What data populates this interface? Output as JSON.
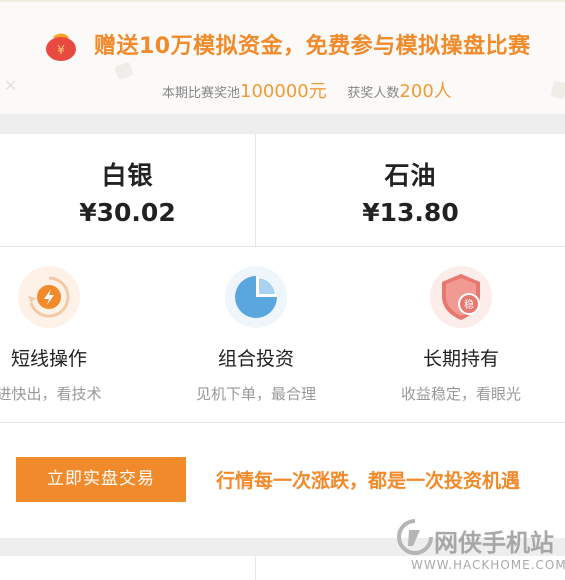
{
  "banner": {
    "title": "赠送10万模拟资金，免费参与模拟操盘比赛",
    "prize_label": "本期比赛奖池",
    "prize_value": "100000元",
    "winners_label": "获奖人数",
    "winners_value": "200人"
  },
  "prices": [
    {
      "name": "白银",
      "value": "¥30.02"
    },
    {
      "name": "石油",
      "value": "¥13.80"
    }
  ],
  "features": [
    {
      "title": "短线操作",
      "desc": "进快出，看技术",
      "icon": "lightning-refresh-icon"
    },
    {
      "title": "组合投资",
      "desc": "见机下单，最合理",
      "icon": "pie-chart-icon"
    },
    {
      "title": "长期持有",
      "desc": "收益稳定，看眼光",
      "icon": "shield-stable-icon"
    }
  ],
  "action": {
    "button_label": "立即实盘交易",
    "slogan": "行情每一次涨跌，都是一次投资机遇"
  },
  "watermark": {
    "name": "网侠手机站",
    "url": "WWW.HACKHOME.COM"
  },
  "colors": {
    "accent": "#f08a2a",
    "gray_text": "#999999"
  }
}
